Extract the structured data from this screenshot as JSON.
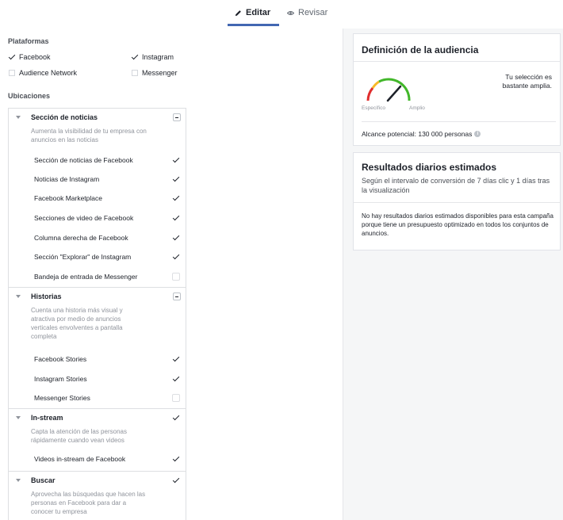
{
  "tabs": {
    "edit_label": "Editar",
    "review_label": "Revisar",
    "accent": "#4267b2"
  },
  "platforms": {
    "title": "Plataformas",
    "items": [
      {
        "label": "Facebook",
        "checked": true
      },
      {
        "label": "Instagram",
        "checked": true
      },
      {
        "label": "Audience Network",
        "checked": false
      },
      {
        "label": "Messenger",
        "checked": false
      }
    ]
  },
  "placements": {
    "title": "Ubicaciones",
    "groups": [
      {
        "title": "Sección de noticias",
        "description": [
          "Aumenta la visibilidad de tu empresa con",
          "anuncios en las noticias"
        ],
        "items": [
          {
            "label": "Sección de noticias de Facebook",
            "checked": true
          },
          {
            "label": "Noticias de Instagram",
            "checked": true
          },
          {
            "label": "Facebook Marketplace",
            "checked": true
          },
          {
            "label": "Secciones de video de Facebook",
            "checked": true
          },
          {
            "label": "Columna derecha de Facebook",
            "checked": true
          },
          {
            "label": "Sección \"Explorar\" de Instagram",
            "checked": true
          },
          {
            "label": "Bandeja de entrada de Messenger",
            "checked": false
          }
        ]
      },
      {
        "title": "Historias",
        "description": [
          "Cuenta una historia más visual y",
          "atractiva por medio de anuncios",
          "verticales envolventes a pantalla",
          "completa"
        ],
        "items": [
          {
            "label": "Facebook Stories",
            "checked": true
          },
          {
            "label": "Instagram Stories",
            "checked": true
          },
          {
            "label": "Messenger Stories",
            "checked": false
          }
        ]
      },
      {
        "title": "In-stream",
        "description": [
          "Capta la atención de las personas",
          "rápidamente cuando vean videos"
        ],
        "items": [
          {
            "label": "Videos in-stream de Facebook",
            "checked": true
          }
        ]
      },
      {
        "title": "Buscar",
        "description": [
          "Aprovecha las búsquedas que hacen las",
          "personas en Facebook para dar a",
          "conocer tu empresa"
        ],
        "items": []
      }
    ]
  },
  "audience": {
    "title": "Definición de la audiencia",
    "selection_text": "Tu selección es bastante amplia.",
    "gauge_left": "Específico",
    "gauge_right": "Amplio",
    "reach_text": "Alcance potencial: 130 000 personas",
    "gauge_level": 0.8,
    "colors": {
      "red": "#e02e2e",
      "yellow": "#f7b928",
      "green": "#42b72a"
    }
  },
  "results": {
    "title": "Resultados diarios estimados",
    "subtitle": "Según el intervalo de conversión de 7 días clic y 1 días tras la visualización",
    "note": "No hay resultados diarios estimados disponibles para esta campaña porque tiene un presupuesto optimizado en todos los conjuntos de anuncios."
  }
}
